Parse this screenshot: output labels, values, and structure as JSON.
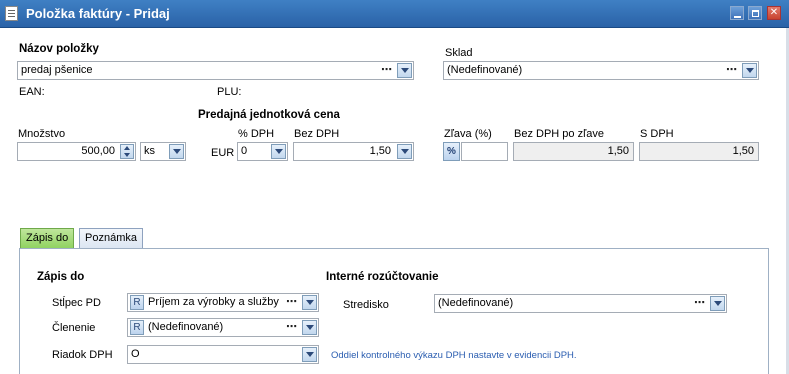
{
  "window": {
    "title": "Položka faktúry - Pridaj",
    "min": "_",
    "max": "□",
    "close": "✕"
  },
  "item": {
    "name_label": "Názov položky",
    "name_value": "predaj pšenice",
    "ean_label": "EAN:",
    "plu_label": "PLU:"
  },
  "warehouse": {
    "label": "Sklad",
    "value": "(Nedefinované)"
  },
  "price": {
    "section_title": "Predajná jednotková cena",
    "quantity_label": "Množstvo",
    "quantity_value": "500,00",
    "unit_value": "ks",
    "currency_label": "EUR",
    "vat_label": "% DPH",
    "vat_value": "0",
    "net_label": "Bez DPH",
    "net_value": "1,50",
    "discount_label": "Zľava (%)",
    "discount_button": "%",
    "net_after_discount_label": "Bez DPH po zľave",
    "net_after_discount_value": "1,50",
    "gross_label": "S DPH",
    "gross_value": "1,50"
  },
  "tabs": [
    {
      "label": "Zápis do",
      "active": true
    },
    {
      "label": "Poznámka",
      "active": false
    }
  ],
  "entry": {
    "section_title": "Zápis do",
    "column_label": "Stĺpec PD",
    "column_badge": "R",
    "column_value": "Príjem za výrobky a služby",
    "breakdown_label": "Členenie",
    "breakdown_badge": "R",
    "breakdown_value": "(Nedefinované)",
    "vat_row_label": "Riadok DPH",
    "vat_row_value": "O"
  },
  "internal": {
    "section_title": "Interné rozúčtovanie",
    "center_label": "Stredisko",
    "center_value": "(Nedefinované)",
    "vat_note": "Oddiel kontrolného výkazu DPH nastavte v evidencii DPH."
  },
  "colors": {
    "titlebar": "#2f6bb0",
    "active_tab": "#8bd15b",
    "link": "#2a5db0"
  },
  "icons": {
    "ellipsis": "⋯",
    "window_icon": "document-icon"
  }
}
